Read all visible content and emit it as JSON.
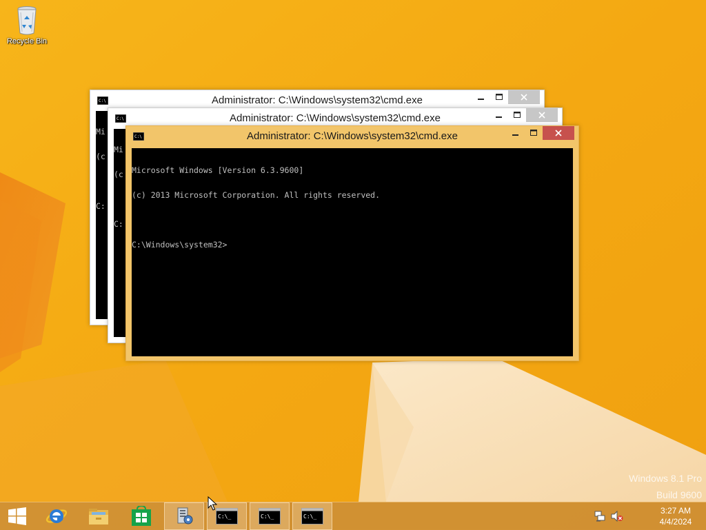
{
  "desktop": {
    "icons": [
      {
        "label": "Recycle Bin",
        "icon": "recycle-bin-icon"
      }
    ],
    "watermark": {
      "line1": "Windows 8.1 Pro",
      "line2": "Build 9600"
    }
  },
  "windows": [
    {
      "title": "Administrator: C:\\Windows\\system32\\cmd.exe",
      "state": "inactive",
      "visible_lines": [
        "Mi",
        "(c",
        "",
        "C:"
      ]
    },
    {
      "title": "Administrator: C:\\Windows\\system32\\cmd.exe",
      "state": "inactive",
      "visible_lines": [
        "Mi",
        "(c",
        "",
        "C:"
      ]
    },
    {
      "title": "Administrator: C:\\Windows\\system32\\cmd.exe",
      "state": "active",
      "console_lines": [
        "Microsoft Windows [Version 6.3.9600]",
        "(c) 2013 Microsoft Corporation. All rights reserved.",
        "",
        "C:\\Windows\\system32>"
      ]
    }
  ],
  "taskbar": {
    "pinned": [
      {
        "name": "start-button",
        "icon": "windows-logo-icon"
      },
      {
        "name": "internet-explorer",
        "icon": "internet-explorer-icon"
      },
      {
        "name": "file-explorer",
        "icon": "folder-icon"
      },
      {
        "name": "store",
        "icon": "store-icon"
      }
    ],
    "running": [
      {
        "name": "server-manager",
        "icon": "server-manager-icon"
      },
      {
        "name": "cmd-1",
        "icon": "cmd-icon",
        "icon_text": "C:\\_"
      },
      {
        "name": "cmd-2",
        "icon": "cmd-icon",
        "icon_text": "C:\\_"
      },
      {
        "name": "cmd-3",
        "icon": "cmd-icon",
        "icon_text": "C:\\_"
      }
    ],
    "tray": {
      "icons": [
        "network-icon",
        "volume-muted-icon"
      ],
      "time": "3:27 AM",
      "date": "4/4/2024"
    }
  },
  "colors": {
    "accent_window": "#f2c56a",
    "close_active": "#c7514d",
    "close_inactive": "#c7c7c7",
    "console_bg": "#000000",
    "console_text": "#c0c0c0",
    "wallpaper_base": "#f4a812"
  }
}
